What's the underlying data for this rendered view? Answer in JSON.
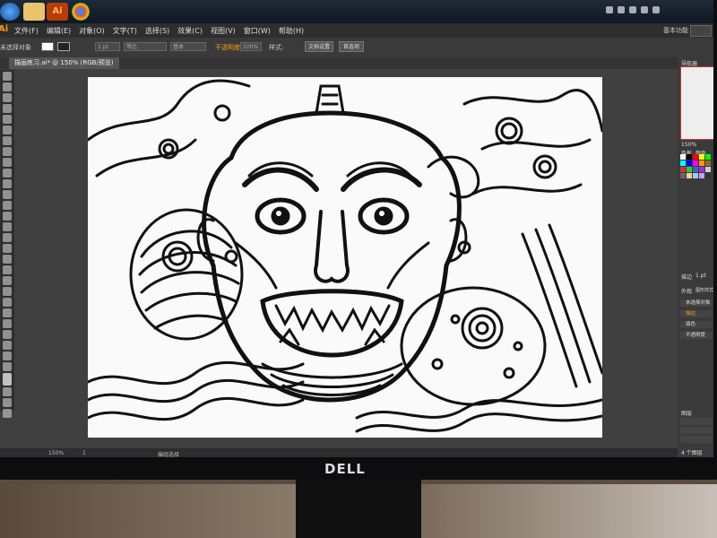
{
  "taskbar": {
    "buttons": [
      {
        "name": "windows-start",
        "color": "#2f79c9"
      },
      {
        "name": "folder",
        "color": "#e9c46a"
      },
      {
        "name": "illustrator",
        "color": "#b83d00",
        "label": "Ai"
      },
      {
        "name": "chrome",
        "color": "#e44d26"
      }
    ]
  },
  "menubar": {
    "app_logo": "Ai",
    "items": [
      "文件(F)",
      "编辑(E)",
      "对象(O)",
      "文字(T)",
      "选择(S)",
      "效果(C)",
      "视图(V)",
      "窗口(W)",
      "帮助(H)"
    ],
    "workspace": "基本功能"
  },
  "control_bar": {
    "selection_status": "未选择对象",
    "stroke_weight": "1 pt",
    "stroke_style": "等比",
    "basic_label": "基本",
    "opacity_label": "不透明度",
    "opacity_value": "100%",
    "style_label": "样式:",
    "doc_setup": "文档设置",
    "preferences": "首选项"
  },
  "document_tab": {
    "label": "描画练习.ai* @ 150% (RGB/预览)"
  },
  "status_bar": {
    "zoom": "150%",
    "page": "1",
    "mode": "编组选择"
  },
  "right_panel": {
    "navigator": "导航器",
    "navigator_zoom": "150%",
    "color_tab": "色板",
    "color_tab2": "颜色",
    "stroke_label": "描边",
    "stroke_value": "1 pt",
    "appearance": "外观",
    "graphic_styles": "图形样式",
    "appearance_item": "未选择对象",
    "stroke_row": "描边",
    "fill_row": "填色",
    "opacity_row": "不透明度",
    "layers": "图层",
    "layers_count": "4 个图层"
  },
  "swatch_colors": [
    "#ffffff",
    "#000000",
    "#ff0000",
    "#ffff00",
    "#00ff00",
    "#00ffff",
    "#0000ff",
    "#ff00ff",
    "#ff9900",
    "#996633",
    "#cc3333",
    "#33cc33",
    "#3366cc",
    "#9933cc",
    "#cccccc",
    "#666666",
    "#ffcc99",
    "#99ccff",
    "#cc99ff",
    "#333333"
  ],
  "monitor_brand": "DELL"
}
